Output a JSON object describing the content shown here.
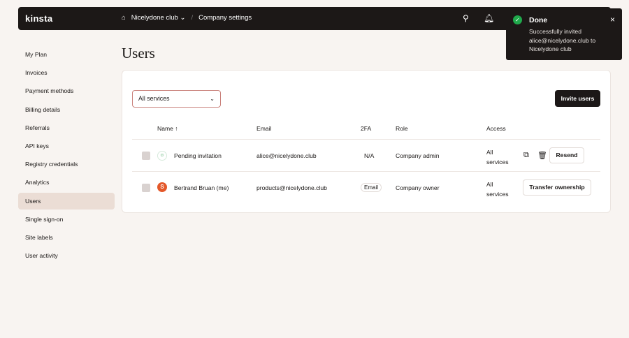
{
  "topbar": {
    "logo": "kinsta",
    "company": "Nicelydone club",
    "page": "Company settings"
  },
  "sidebar": [
    "My Plan",
    "Invoices",
    "Payment methods",
    "Billing details",
    "Referrals",
    "API keys",
    "Registry credentials",
    "Analytics",
    "Users",
    "Single sign-on",
    "Site labels",
    "User activity"
  ],
  "title": "Users",
  "filter": "All services",
  "invite": "Invite users",
  "columns": {
    "name": "Name ↑",
    "email": "Email",
    "twofa": "2FA",
    "role": "Role",
    "access": "Access"
  },
  "rows": [
    {
      "name": "Pending invitation",
      "email": "alice@nicelydone.club",
      "twofa": "N/A",
      "role": "Company admin",
      "access1": "All",
      "access2": "services",
      "action": "Resend"
    },
    {
      "name": "Bertrand Bruan (me)",
      "email": "products@nicelydone.club",
      "twofa": "Email",
      "role": "Company owner",
      "access1": "All",
      "access2": "services",
      "action": "Transfer ownership"
    }
  ],
  "toast": {
    "title": "Done",
    "message": "Successfully invited alice@nicelydone.club to Nicelydone club",
    "close": "×"
  }
}
